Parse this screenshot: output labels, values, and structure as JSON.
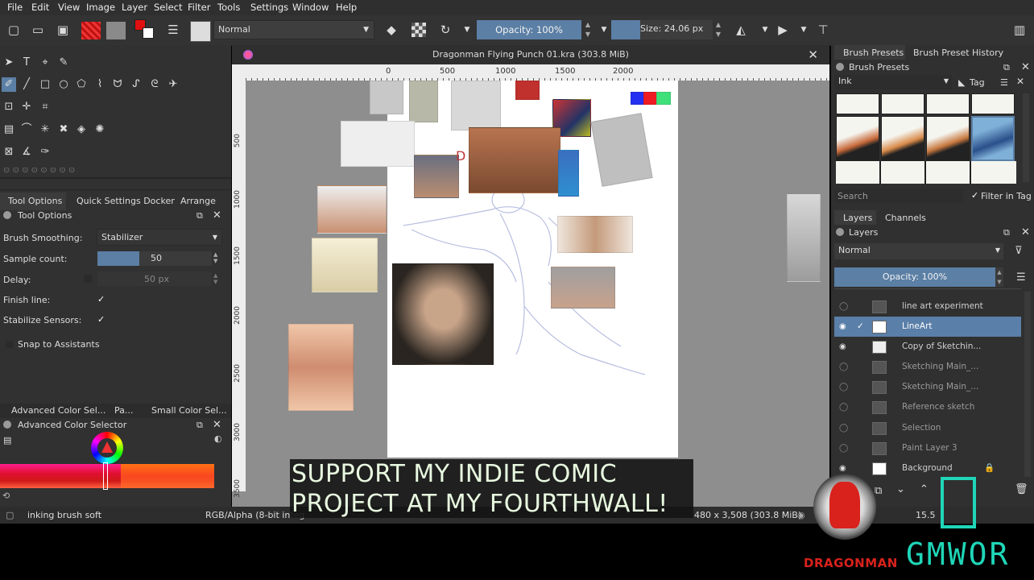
{
  "menu": [
    "File",
    "Edit",
    "View",
    "Image",
    "Layer",
    "Select",
    "Filter",
    "Tools",
    "Settings",
    "Window",
    "Help"
  ],
  "toolbar": {
    "blend_mode": "Normal",
    "opacity": "Opacity: 100%",
    "size": "Size: 24.06 px"
  },
  "document": {
    "title": "Dragonman Flying Punch 01.kra (303.8 MiB)",
    "ruler_h": [
      "0",
      "500",
      "1000",
      "1500",
      "2000"
    ],
    "ruler_v": [
      "500",
      "1000",
      "1500",
      "2000",
      "2500",
      "3000",
      "3500"
    ]
  },
  "left_dock": {
    "tabs": [
      "Tool Options",
      "Quick Settings Docker",
      "Arrange"
    ],
    "panel_title": "Tool Options",
    "brush_smoothing_label": "Brush Smoothing:",
    "brush_smoothing_value": "Stabilizer",
    "sample_count_label": "Sample count:",
    "sample_count_value": "50",
    "delay_label": "Delay:",
    "delay_value": "50 px",
    "finish_line_label": "Finish line:",
    "stabilize_label": "Stabilize Sensors:",
    "snap_label": "Snap to Assistants",
    "color_tabs": [
      "Advanced Color Sel...",
      "Pa...",
      "Small Color Sel..."
    ],
    "color_panel_title": "Advanced Color Selector"
  },
  "right_dock": {
    "tabs": [
      "Brush Presets",
      "Brush Preset History"
    ],
    "presets_title": "Brush Presets",
    "preset_tag": "Ink",
    "tag_label": "Tag",
    "search_placeholder": "Search",
    "filter_label": "Filter in Tag",
    "layer_tabs": [
      "Layers",
      "Channels"
    ],
    "layers_title": "Layers",
    "layer_blend": "Normal",
    "layer_opacity": "Opacity:  100%",
    "layers": [
      {
        "name": "line art experiment",
        "visible": false,
        "selected": false
      },
      {
        "name": "LineArt",
        "visible": true,
        "selected": true
      },
      {
        "name": "Copy of Sketchin...",
        "visible": true,
        "selected": false
      },
      {
        "name": "Sketching Main_...",
        "visible": false,
        "selected": false
      },
      {
        "name": "Sketching Main_...",
        "visible": false,
        "selected": false
      },
      {
        "name": "Reference sketch",
        "visible": false,
        "selected": false
      },
      {
        "name": "Selection",
        "visible": false,
        "selected": false
      },
      {
        "name": "Paint Layer 3",
        "visible": false,
        "selected": false
      },
      {
        "name": "Background",
        "visible": true,
        "selected": false
      }
    ]
  },
  "status": {
    "brush": "inking brush soft",
    "color_mode": "RGB/Alpha (8-bit integ",
    "dims": "480 x 3,508 (303.8 MiB)",
    "zoom": "15.5"
  },
  "overlay": {
    "subtitle_line1": "SUPPORT MY INDIE COMIC",
    "subtitle_line2": "PROJECT AT MY FOURTHWALL!",
    "logo_left": "DRAGONMAN",
    "logo_right": "GMWOR"
  },
  "colors": {
    "accent": "#5b7fa5",
    "selected_layer": "#5a7fa8",
    "subtitle_text": "#e8f9e0",
    "logo_red": "#d9221c",
    "logo_teal": "#1fd6b8"
  }
}
